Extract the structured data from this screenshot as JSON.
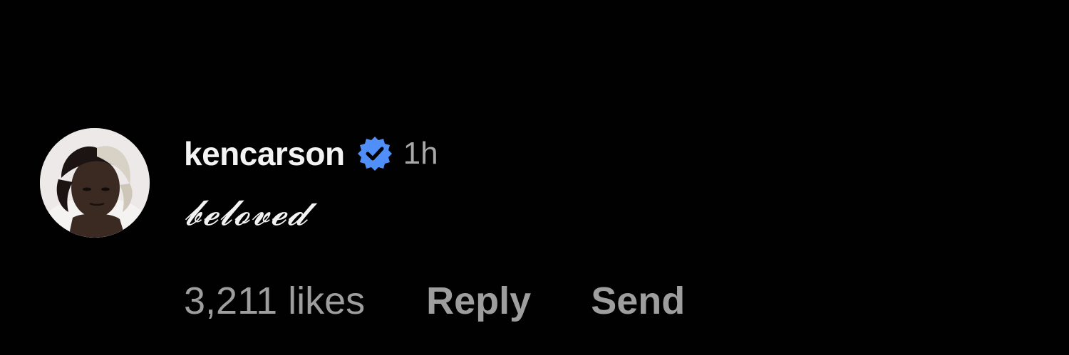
{
  "comment": {
    "username": "kencarson",
    "verified": true,
    "timestamp": "1h",
    "text": "𝓫𝓮𝓵𝓸𝓿𝓮𝓭",
    "avatar_icon": "profile-photo",
    "verified_icon": "verified-badge-icon",
    "verified_color": "#4f8ff7"
  },
  "actions": {
    "likes_label": "3,211 likes",
    "reply_label": "Reply",
    "send_label": "Send"
  },
  "colors": {
    "background": "#010101",
    "primary_text": "#f3f3f3",
    "secondary_text": "#9e9e9e"
  }
}
